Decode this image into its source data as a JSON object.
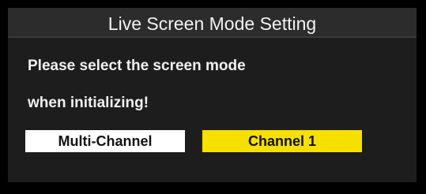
{
  "dialog": {
    "title": "Live Screen Mode Setting",
    "message_line_1": "Please select the screen mode",
    "message_line_2": "when initializing!",
    "options": [
      {
        "label": "Multi-Channel",
        "selected": false
      },
      {
        "label": "Channel  1",
        "selected": true
      }
    ]
  },
  "colors": {
    "background": "#000000",
    "dialog_background": "#1d1d1d",
    "title_bar": "#2c2c2c",
    "text": "#f0f0f0",
    "option_default": "#ffffff",
    "option_selected": "#f5e000"
  }
}
